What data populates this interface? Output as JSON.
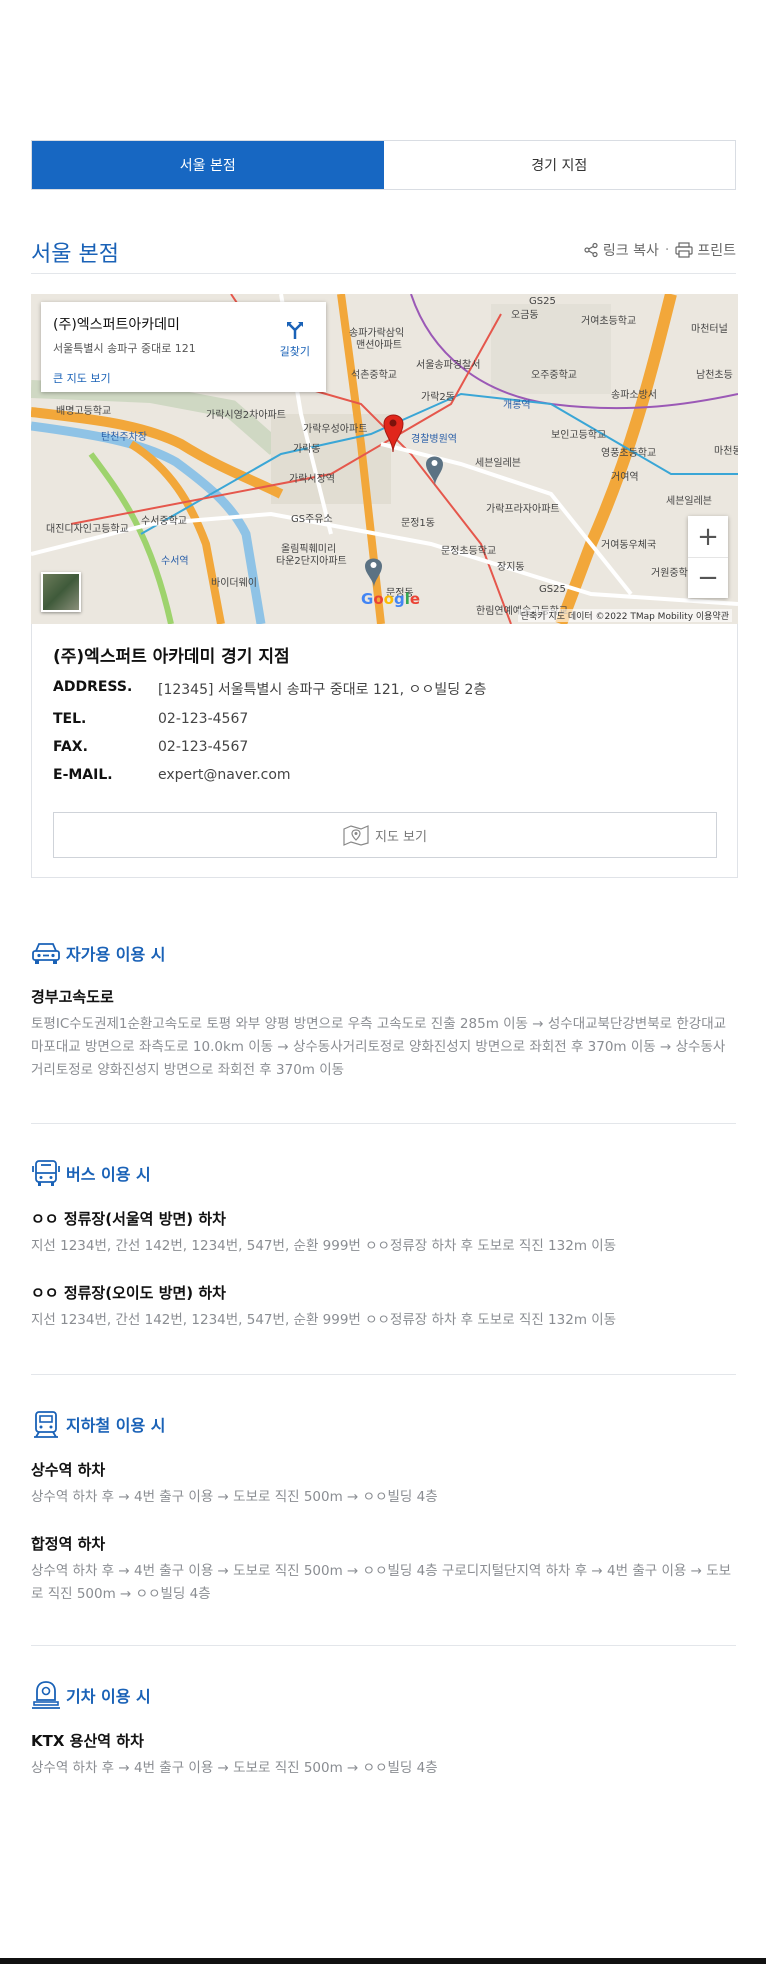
{
  "tabs": [
    {
      "label": "서울 본점",
      "active": true
    },
    {
      "label": "경기 지점",
      "active": false
    }
  ],
  "section_title": "서울 본점",
  "tools": {
    "copy_link": "링크 복사",
    "print": "프린트"
  },
  "map": {
    "card_name": "(주)엑스퍼트아카데미",
    "card_address": "서울특별시 송파구 중대로 121",
    "big_map": "큰 지도 보기",
    "directions": "길찾기",
    "zoom_in": "+",
    "zoom_out": "−",
    "google": "Google",
    "attribution": "단축키  지도 데이터 ©2022 TMap Mobility  이용약관",
    "labels": {
      "l1": "거여초등학교",
      "l2": "오금동",
      "l3": "마천터널",
      "l4": "송파가락삼익",
      "l5": "맨션아파트",
      "l6": "서울송파경찰서",
      "l7": "석촌중학교",
      "l8": "오주중학교",
      "l9": "송파소방서",
      "l10": "남천초등",
      "l11": "배명고등학교",
      "l12": "탄천주차장",
      "l13": "가락시영2차아파트",
      "l14": "가락2동",
      "l15": "개롱역",
      "l16": "보인고등학교",
      "l17": "영풍초등학교",
      "l18": "마천동",
      "l19": "가락우성아파트",
      "l20": "경찰병원역",
      "l21": "가락시장역",
      "l22": "세븐일레븐",
      "l23": "거여역",
      "l24": "세븐일레븐",
      "l25": "대진디자인고등학교",
      "l26": "수서중학교",
      "l27": "GS주유소",
      "l28": "가락프라자아파트",
      "l29": "문정1동",
      "l30": "올림픽훼미리",
      "l31": "타운2단지아파트",
      "l32": "문정초등학교",
      "l33": "거여동우체국",
      "l34": "거원중학교",
      "l35": "수서역",
      "l36": "바이더웨이",
      "l37": "문정동",
      "l38": "GS25",
      "l39": "한림연예예술고등학교",
      "l40": "GS25",
      "l41": "가락동",
      "l42": "장지동"
    }
  },
  "branch": {
    "title": "(주)엑스퍼트 아카데미 경기 지점",
    "rows": [
      {
        "key": "ADDRESS.",
        "value": "[12345] 서울특별시 송파구 중대로 121, ㅇㅇ빌딩 2층"
      },
      {
        "key": "TEL.",
        "value": "02-123-4567"
      },
      {
        "key": "FAX.",
        "value": "02-123-4567"
      },
      {
        "key": "E-MAIL.",
        "value": "expert@naver.com"
      }
    ],
    "view_map": "지도 보기"
  },
  "car": {
    "heading": "자가용 이용 시",
    "sub": "경부고속도로",
    "body": "토평IC수도권제1순환고속도로 토평 와부 양평 방면으로 우측 고속도로 진출 285m 이동 → 성수대교북단강변북로 한강대교 마포대교 방면으로 좌측도로 10.0km 이동 → 상수동사거리토정로 양화진성지 방면으로 좌회전 후 370m 이동 → 상수동사거리토정로 양화진성지 방면으로 좌회전 후 370m 이동"
  },
  "bus": {
    "heading": "버스 이용 시",
    "items": [
      {
        "sub": "ㅇㅇ 정류장(서울역 방면) 하차",
        "body": "지선 1234번, 간선 142번, 1234번, 547번, 순환 999번 ㅇㅇ정류장 하차 후 도보로 직진 132m 이동"
      },
      {
        "sub": "ㅇㅇ 정류장(오이도 방면) 하차",
        "body": "지선 1234번, 간선 142번, 1234번, 547번, 순환 999번 ㅇㅇ정류장 하차 후 도보로 직진 132m 이동"
      }
    ]
  },
  "subway": {
    "heading": "지하철 이용 시",
    "items": [
      {
        "sub": "상수역 하차",
        "body": "상수역 하차 후 → 4번 출구 이용 → 도보로 직진 500m → ㅇㅇ빌딩 4층"
      },
      {
        "sub": "합정역 하차",
        "body": "상수역 하차 후 → 4번 출구 이용 → 도보로 직진 500m → ㅇㅇ빌딩 4층 구로디지털단지역 하차 후 → 4번 출구 이용 → 도보로 직진 500m → ㅇㅇ빌딩 4층"
      }
    ]
  },
  "train": {
    "heading": "기차 이용 시",
    "sub": "KTX 용산역 하차",
    "body": "상수역 하차 후 → 4번 출구 이용 → 도보로 직진 500m → ㅇㅇ빌딩 4층"
  },
  "colors": {
    "accent": "#1767c2",
    "pin": "#e0261b"
  }
}
